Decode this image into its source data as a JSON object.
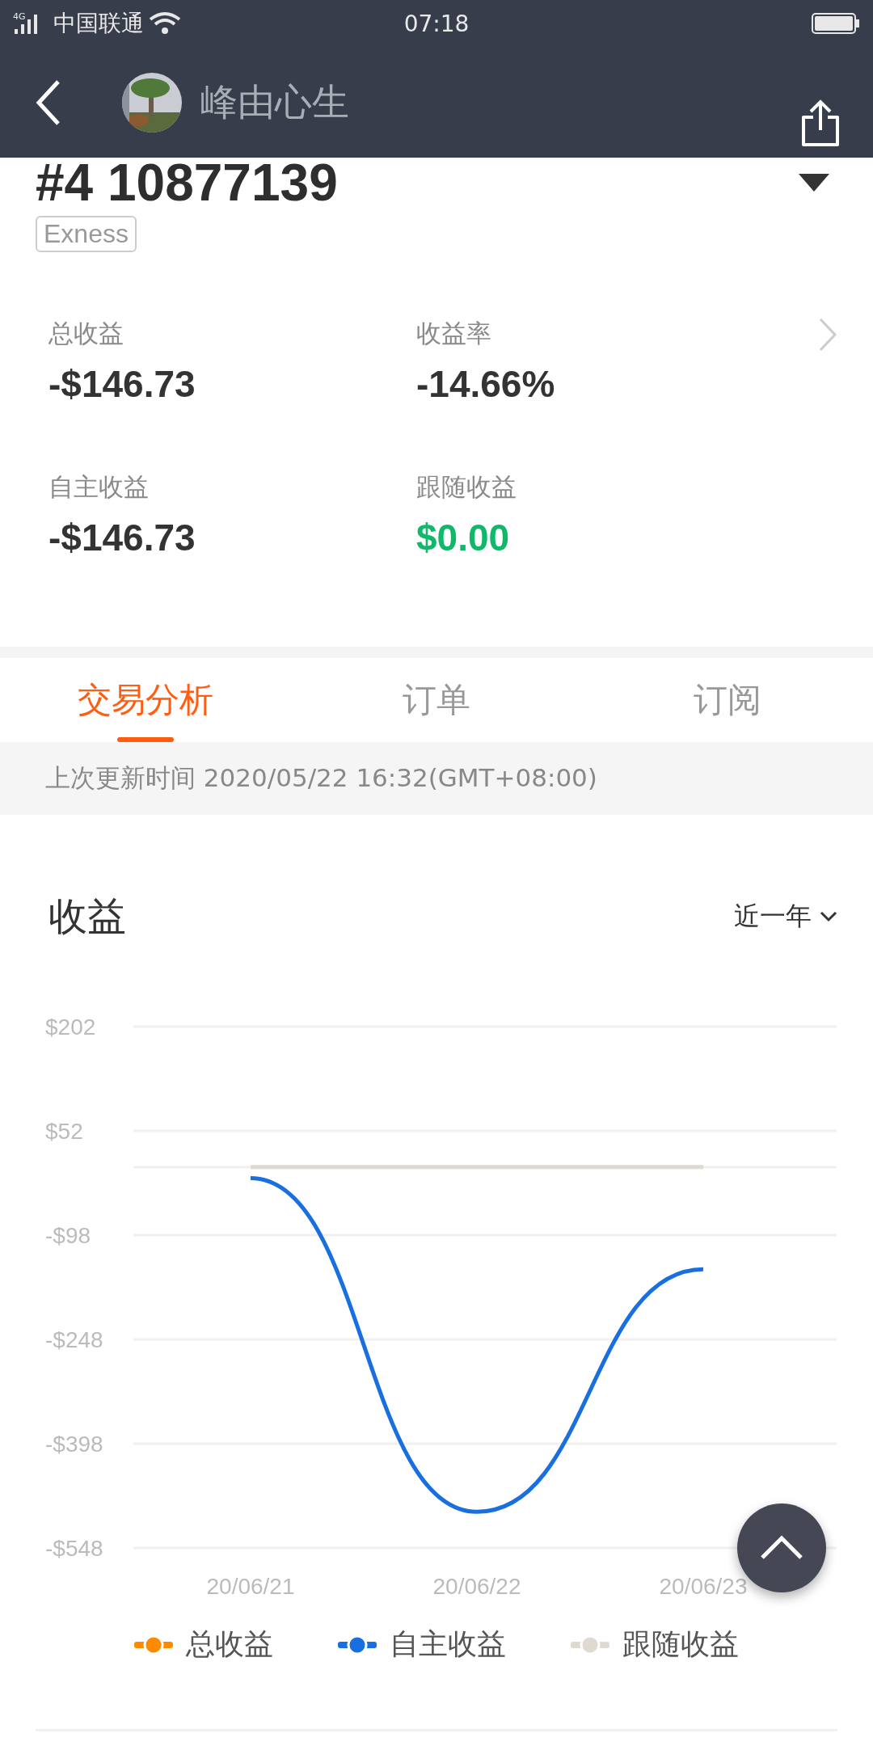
{
  "status_bar": {
    "network": "4G",
    "carrier": "中国联通",
    "time": "07:18"
  },
  "header": {
    "name": "峰由心生"
  },
  "account": {
    "title": "#4 10877139",
    "broker": "Exness"
  },
  "stats": [
    {
      "label": "总收益",
      "value": "-$146.73",
      "color": "#333333"
    },
    {
      "label": "收益率",
      "value": "-14.66%",
      "color": "#333333"
    },
    {
      "label": "自主收益",
      "value": "-$146.73",
      "color": "#333333"
    },
    {
      "label": "跟随收益",
      "value": "$0.00",
      "color": "#10b86a"
    }
  ],
  "tabs": [
    {
      "label": "交易分析",
      "selected": true
    },
    {
      "label": "订单",
      "selected": false
    },
    {
      "label": "订阅",
      "selected": false
    }
  ],
  "update_time": "上次更新时间 2020/05/22 16:32(GMT+08:00)",
  "chart_section": {
    "title": "收益",
    "period": "近一年",
    "chart_data": {
      "type": "line",
      "grid": true,
      "categories": [
        "20/06/21",
        "20/06/22",
        "20/06/23"
      ],
      "yticks": [
        {
          "value": 202,
          "label": "$202"
        },
        {
          "value": 52,
          "label": "$52"
        },
        {
          "value": -98,
          "label": "-$98"
        },
        {
          "value": -248,
          "label": "-$248"
        },
        {
          "value": -398,
          "label": "-$398"
        },
        {
          "value": -548,
          "label": "-$548"
        }
      ],
      "ylim": [
        -548,
        202
      ],
      "series": [
        {
          "name": "总收益",
          "color": "#ff8a00",
          "values": [
            null,
            null,
            null
          ]
        },
        {
          "name": "自主收益",
          "color": "#1a6fe0",
          "values": [
            -16,
            -496,
            -147
          ]
        },
        {
          "name": "跟随收益",
          "color": "#e0d9cf",
          "values": [
            0,
            0,
            0
          ]
        }
      ]
    }
  }
}
